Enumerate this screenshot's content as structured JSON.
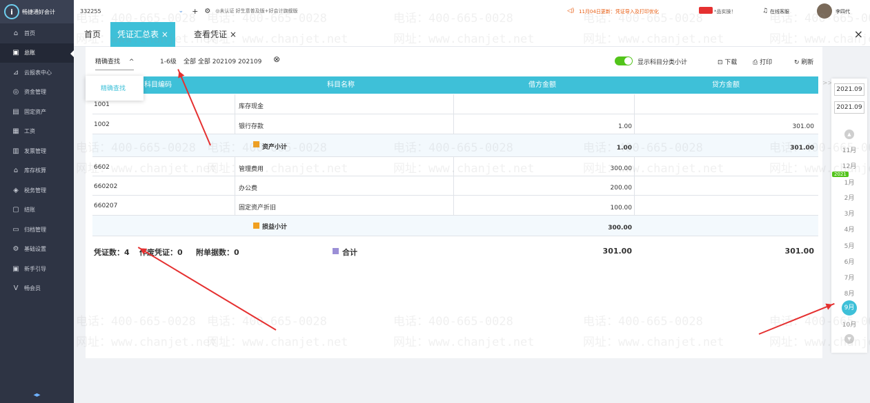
{
  "sidebar": {
    "logo_text": "畅捷通好会计",
    "items": [
      {
        "label": "首页",
        "icon": "home-icon",
        "glyph": "⌂"
      },
      {
        "label": "总账",
        "icon": "ledger-icon",
        "glyph": "▣"
      },
      {
        "label": "云报表中心",
        "icon": "chart-icon",
        "glyph": "⊿"
      },
      {
        "label": "资金管理",
        "icon": "money-icon",
        "glyph": "◎"
      },
      {
        "label": "固定资产",
        "icon": "asset-icon",
        "glyph": "▤"
      },
      {
        "label": "工资",
        "icon": "salary-icon",
        "glyph": "▦"
      },
      {
        "label": "发票管理",
        "icon": "invoice-icon",
        "glyph": "▥"
      },
      {
        "label": "库存核算",
        "icon": "inventory-icon",
        "glyph": "⌂"
      },
      {
        "label": "税务管理",
        "icon": "tax-icon",
        "glyph": "◈"
      },
      {
        "label": "结账",
        "icon": "close-books-icon",
        "glyph": "▢"
      },
      {
        "label": "归档管理",
        "icon": "archive-icon",
        "glyph": "▭"
      },
      {
        "label": "基础设置",
        "icon": "settings-icon",
        "glyph": "⚙"
      },
      {
        "label": "新手引导",
        "icon": "guide-icon",
        "glyph": "▣"
      },
      {
        "label": "畅会员",
        "icon": "vip-icon",
        "glyph": "V"
      }
    ],
    "collapse_label": "◂▸"
  },
  "topbar": {
    "account": "332255",
    "add": "+",
    "cert_text": "◎未认证 好生意普及版+好会计旗舰版",
    "notice": "11月04日更新：凭证导入及打印优化",
    "promo": "*品实操！",
    "online_service": "在线客服",
    "user": "李四代"
  },
  "tabs": [
    {
      "label": "首页"
    },
    {
      "label": "凭证汇总表 ×"
    },
    {
      "label": "查看凭证 ×"
    }
  ],
  "close_label": "×",
  "filter": {
    "search_label": "精确查找",
    "search_toggle": "^",
    "level": "1-6级",
    "condition": "全部 全部 202109 202109",
    "clear": "⊗",
    "subtotal_label": "显示科目分类小计",
    "subtotal_on": true,
    "download": "下载",
    "print": "打印",
    "refresh": "刷新"
  },
  "popup": {
    "item": "精确查找"
  },
  "table": {
    "headers": [
      "科目编码",
      "科目名称",
      "借方金额",
      "贷方金额"
    ],
    "rows": [
      {
        "code": "1001",
        "name": "库存现金",
        "debit": "",
        "credit": "",
        "subtotal": false
      },
      {
        "code": "1002",
        "name": "银行存款",
        "debit": "1.00",
        "credit": "301.00",
        "subtotal": false
      },
      {
        "code": "",
        "name": "资产小计",
        "debit": "1.00",
        "credit": "301.00",
        "subtotal": true
      },
      {
        "code": "6602",
        "name": "管理费用",
        "debit": "300.00",
        "credit": "",
        "subtotal": false
      },
      {
        "code": "660202",
        "name": "办公费",
        "debit": "200.00",
        "credit": "",
        "subtotal": false
      },
      {
        "code": "660207",
        "name": "固定资产折旧",
        "debit": "100.00",
        "credit": "",
        "subtotal": false
      },
      {
        "code": "",
        "name": "损益小计",
        "debit": "300.00",
        "credit": "",
        "subtotal": true
      }
    ],
    "footer": {
      "voucher_count": "凭证数：4",
      "void_count": "作废凭证：0",
      "attach_count": "附单据数：0",
      "total_label": "合计",
      "total_debit": "301.00",
      "total_credit": "301.00"
    }
  },
  "period_panel": {
    "start": "2021.09",
    "end": "2021.09",
    "year_badge": "2021",
    "up": "▲",
    "down": "▼",
    "expand": ">>",
    "months": [
      "11月",
      "12月",
      "1月",
      "2月",
      "3月",
      "4月",
      "5月",
      "6月",
      "7月",
      "8月",
      "9月",
      "10月"
    ],
    "current_month": "9月"
  },
  "watermark": {
    "phone": "电话：400-665-0028",
    "site": "网址：www.chanjet.net"
  },
  "colors": {
    "accent": "#3ec0d8",
    "sidebar": "#2e3444",
    "arrow": "#e53030",
    "notice": "#e8590c"
  }
}
